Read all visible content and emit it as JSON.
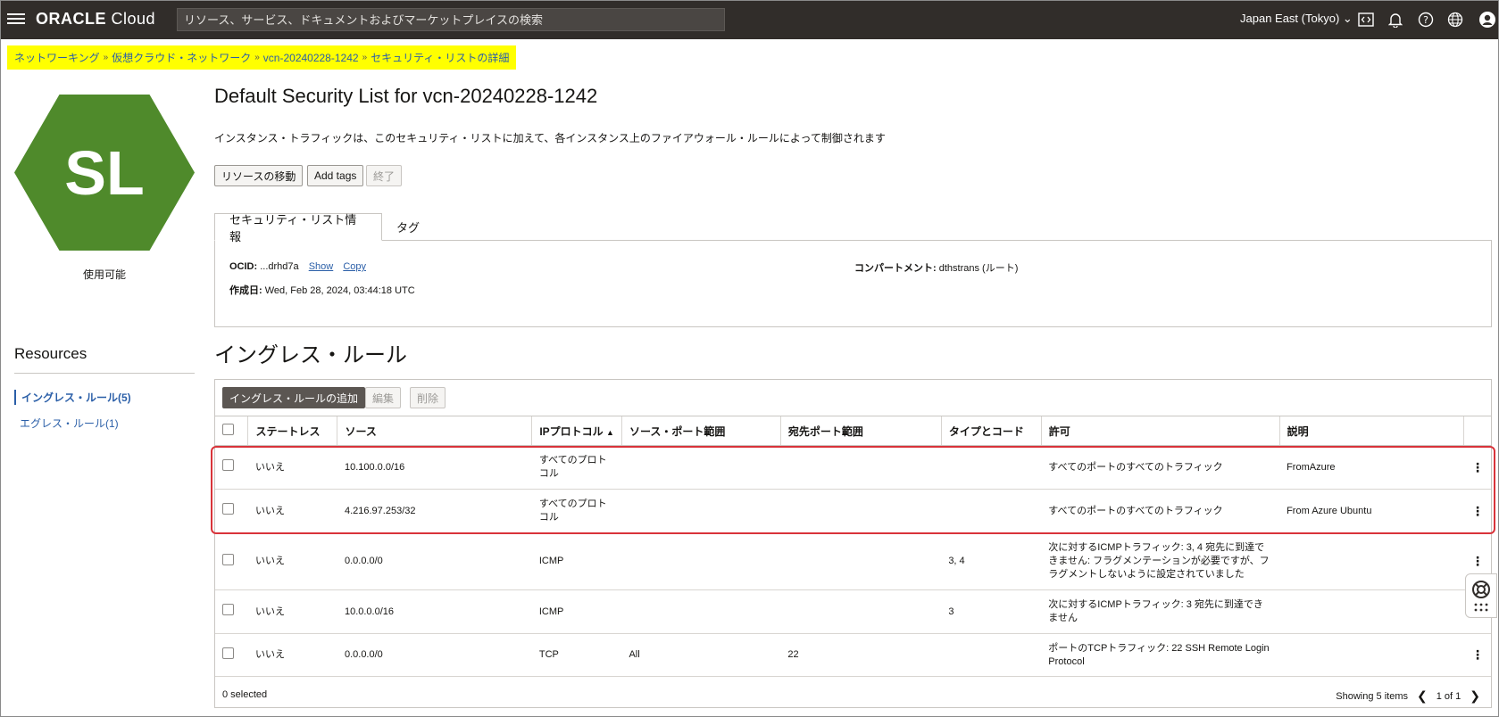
{
  "topbar": {
    "logo_bold": "ORACLE",
    "logo_light": " Cloud",
    "search_placeholder": "リソース、サービス、ドキュメントおよびマーケットプレイスの検索",
    "region": "Japan East (Tokyo)"
  },
  "breadcrumb": {
    "items": [
      "ネットワーキング",
      "仮想クラウド・ネットワーク",
      "vcn-20240228-1242"
    ],
    "current": "セキュリティ・リストの詳細"
  },
  "resource": {
    "icon_text": "SL",
    "status": "使用可能",
    "title": "Default Security List for vcn-20240228-1242",
    "description": "インスタンス・トラフィックは、このセキュリティ・リストに加えて、各インスタンス上のファイアウォール・ルールによって制御されます"
  },
  "actions": {
    "move": "リソースの移動",
    "add_tags": "Add tags",
    "terminate": "終了"
  },
  "tabs": {
    "info": "セキュリティ・リスト情報",
    "tags": "タグ"
  },
  "info": {
    "ocid_label": "OCID:",
    "ocid_value": "...drhd7a",
    "show": "Show",
    "copy": "Copy",
    "created_label": "作成日:",
    "created_value": "Wed, Feb 28, 2024, 03:44:18 UTC",
    "compartment_label": "コンパートメント:",
    "compartment_value": "dthstrans (ルート)"
  },
  "sidebar": {
    "title": "Resources",
    "items": [
      {
        "label": "イングレス・ルール(5)"
      },
      {
        "label": "エグレス・ルール(1)"
      }
    ]
  },
  "ingress": {
    "title": "イングレス・ルール",
    "add": "イングレス・ルールの追加",
    "edit": "編集",
    "delete": "削除",
    "columns": [
      "ステートレス",
      "ソース",
      "IPプロトコル",
      "ソース・ポート範囲",
      "宛先ポート範囲",
      "タイプとコード",
      "許可",
      "説明"
    ],
    "rows": [
      {
        "stateless": "いいえ",
        "source": "10.100.0.0/16",
        "protocol": "すべてのプロトコル",
        "src_port": "",
        "dst_port": "",
        "type_code": "",
        "allows": "すべてのポートのすべてのトラフィック",
        "description": "FromAzure"
      },
      {
        "stateless": "いいえ",
        "source": "4.216.97.253/32",
        "protocol": "すべてのプロトコル",
        "src_port": "",
        "dst_port": "",
        "type_code": "",
        "allows": "すべてのポートのすべてのトラフィック",
        "description": "From Azure Ubuntu"
      },
      {
        "stateless": "いいえ",
        "source": "0.0.0.0/0",
        "protocol": "ICMP",
        "src_port": "",
        "dst_port": "",
        "type_code": "3, 4",
        "allows": "次に対するICMPトラフィック: 3, 4 宛先に到達できません: フラグメンテーションが必要ですが、フラグメントしないように設定されていました",
        "description": ""
      },
      {
        "stateless": "いいえ",
        "source": "10.0.0.0/16",
        "protocol": "ICMP",
        "src_port": "",
        "dst_port": "",
        "type_code": "3",
        "allows": "次に対するICMPトラフィック: 3 宛先に到達できません",
        "description": ""
      },
      {
        "stateless": "いいえ",
        "source": "0.0.0.0/0",
        "protocol": "TCP",
        "src_port": "All",
        "dst_port": "22",
        "type_code": "",
        "allows": "ポートのTCPトラフィック: 22 SSH Remote Login Protocol",
        "description": ""
      }
    ],
    "selected": "0 selected",
    "showing": "Showing 5 items",
    "page": "1 of 1"
  }
}
